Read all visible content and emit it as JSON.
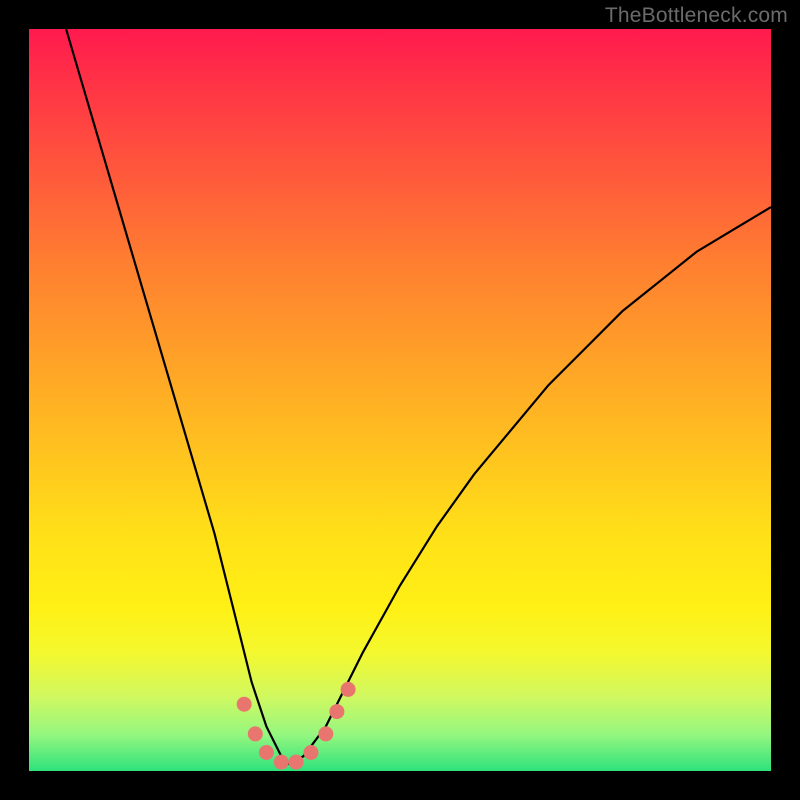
{
  "watermark": "TheBottleneck.com",
  "chart_data": {
    "type": "line",
    "title": "",
    "xlabel": "",
    "ylabel": "",
    "xlim": [
      0,
      100
    ],
    "ylim": [
      0,
      100
    ],
    "series": [
      {
        "name": "curve",
        "x": [
          5,
          10,
          15,
          20,
          25,
          28,
          30,
          32,
          34,
          35,
          37,
          40,
          45,
          50,
          55,
          60,
          65,
          70,
          75,
          80,
          85,
          90,
          95,
          100
        ],
        "values": [
          100,
          83,
          66,
          49,
          32,
          20,
          12,
          6,
          2,
          1,
          2,
          6,
          16,
          25,
          33,
          40,
          46,
          52,
          57,
          62,
          66,
          70,
          73,
          76
        ]
      },
      {
        "name": "markers",
        "x": [
          29,
          30.5,
          32,
          34,
          36,
          38,
          40,
          41.5,
          43
        ],
        "values": [
          9,
          5,
          2.5,
          1.2,
          1.2,
          2.5,
          5,
          8,
          11
        ]
      }
    ],
    "colors": {
      "curve_stroke": "#000000",
      "marker_fill": "#e8766f",
      "gradient_top": "#ff1a4e",
      "gradient_bottom": "#2ee27c"
    }
  }
}
